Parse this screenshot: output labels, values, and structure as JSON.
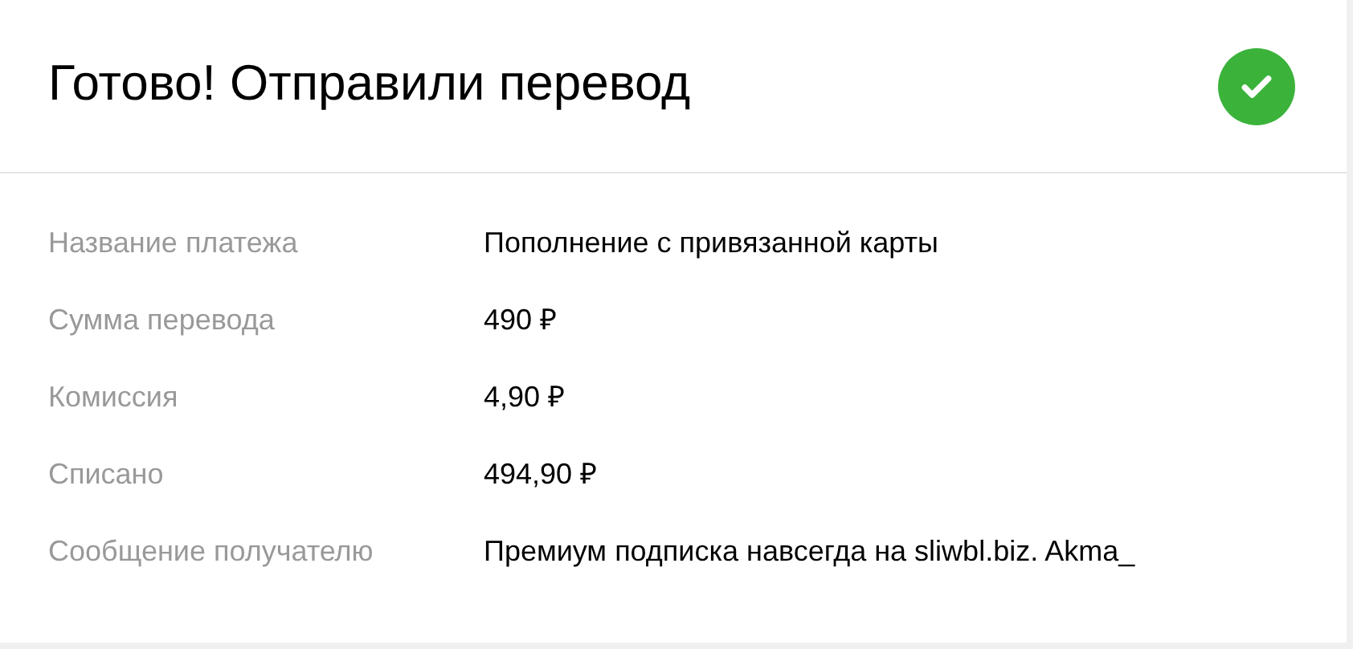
{
  "header": {
    "title": "Готово! Отправили перевод",
    "completed": true
  },
  "details": [
    {
      "label": "Название платежа",
      "value": "Пополнение с привязанной карты"
    },
    {
      "label": "Сумма перевода",
      "value": "490 ₽"
    },
    {
      "label": "Комиссия",
      "value": "4,90 ₽"
    },
    {
      "label": "Списано",
      "value": "494,90 ₽"
    },
    {
      "label": "Сообщение получателю",
      "value": "Премиум подписка навсегда на sliwbl.biz. Akma_"
    }
  ]
}
